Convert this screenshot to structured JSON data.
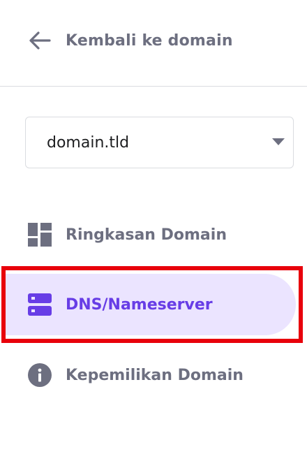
{
  "back": {
    "label": "Kembali ke domain",
    "icon": "arrow-left-icon"
  },
  "domain_select": {
    "value": "domain.tld",
    "icon": "caret-down-icon"
  },
  "nav": {
    "items": [
      {
        "label": "Ringkasan Domain",
        "icon": "dashboard-grid-icon",
        "active": false
      },
      {
        "label": "DNS/Nameserver",
        "icon": "server-icon",
        "active": true
      },
      {
        "label": "Kepemilikan Domain",
        "icon": "info-icon",
        "active": false
      }
    ]
  },
  "colors": {
    "text_muted": "#6d6f80",
    "accent": "#673de6",
    "active_bg": "#ebe4ff",
    "highlight": "#e8000b",
    "border": "#dadce0"
  }
}
